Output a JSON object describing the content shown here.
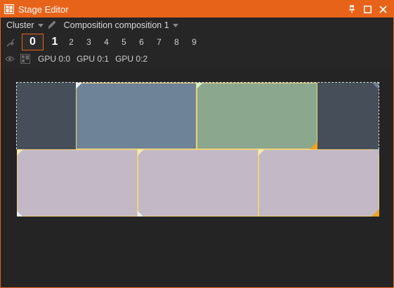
{
  "window": {
    "title": "Stage Editor",
    "buttons": {
      "pin": "📌",
      "maximize": "□",
      "close": "✕"
    }
  },
  "toolbar": {
    "cluster_label": "Cluster",
    "composition_label": "Composition composition 1",
    "numbers": [
      "0",
      "1",
      "2",
      "3",
      "4",
      "5",
      "6",
      "7",
      "8",
      "9"
    ],
    "selected_number": "0",
    "gpus": [
      "GPU 0:0",
      "GPU 0:1",
      "GPU 0:2"
    ]
  },
  "colors": {
    "accent": "#e8631a",
    "tile_dark": "#464f59",
    "tile_slate": "#6e8397",
    "tile_green": "#8ba88e",
    "tile_lilac": "#c2b8c6",
    "tile_border": "#f0d27a",
    "corner_yellow": "#f5e9a8",
    "corner_white": "#e9eef2",
    "corner_orange": "#f0a31e",
    "corner_green": "#d4f0c6"
  },
  "stage": {
    "tiles": [
      {
        "name": "tile-dark-left",
        "color_key": "tile_dark"
      },
      {
        "name": "tile-slate-blue",
        "color_key": "tile_slate"
      },
      {
        "name": "tile-green",
        "color_key": "tile_green"
      },
      {
        "name": "tile-dark-right",
        "color_key": "tile_dark"
      },
      {
        "name": "tile-bottom-1",
        "color_key": "tile_lilac"
      },
      {
        "name": "tile-bottom-2",
        "color_key": "tile_lilac"
      },
      {
        "name": "tile-bottom-3",
        "color_key": "tile_lilac"
      }
    ]
  }
}
